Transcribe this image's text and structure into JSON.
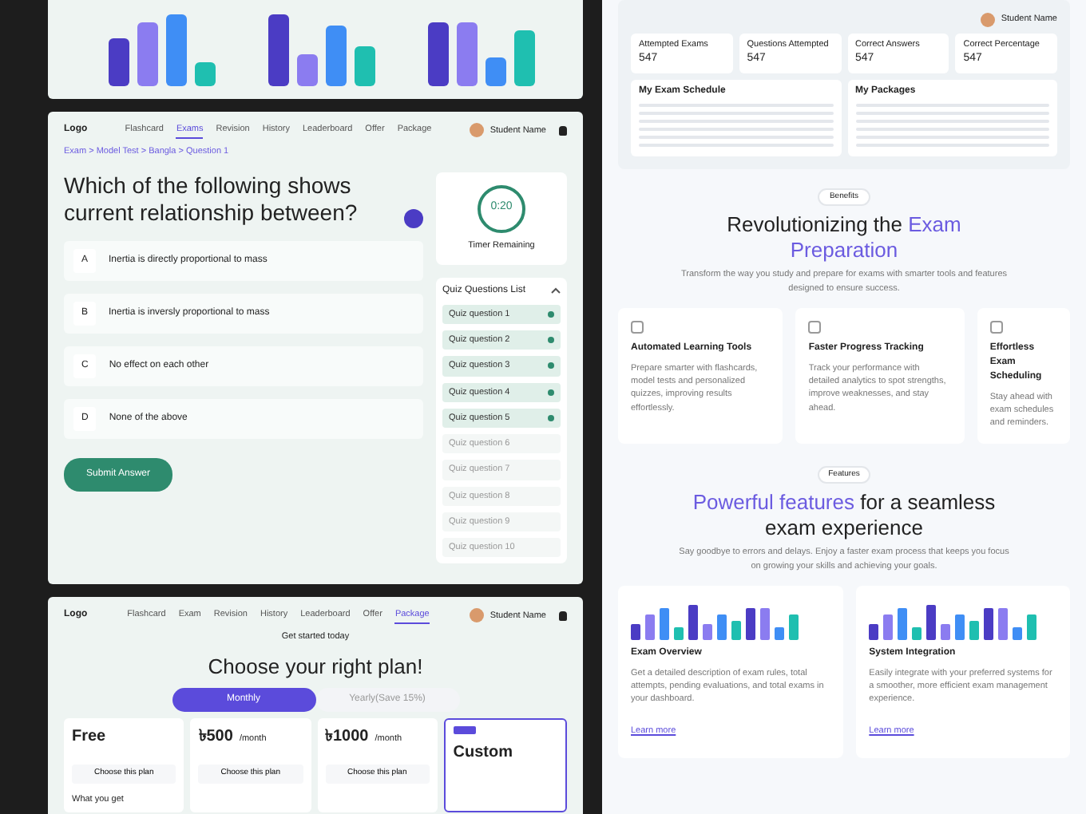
{
  "quiz_page": {
    "logo": "Logo",
    "nav": [
      {
        "label": "Flashcard",
        "selected": false
      },
      {
        "label": "Exams",
        "selected": true
      },
      {
        "label": "Revision",
        "selected": false
      },
      {
        "label": "History",
        "selected": false
      },
      {
        "label": "Leaderboard",
        "selected": false
      },
      {
        "label": "Offer",
        "selected": false
      },
      {
        "label": "Package",
        "selected": false
      }
    ],
    "user_name": "Student Name",
    "breadcrumb": "Exam > Model Test > Bangla > Question 1",
    "question": "Which of the following shows current  relationship between?",
    "options": [
      {
        "letter": "A",
        "text": "Inertia is directly proportional to mass"
      },
      {
        "letter": "B",
        "text": "Inertia is inversly proportional to mass"
      },
      {
        "letter": "C",
        "text": "No effect on each other"
      },
      {
        "letter": "D",
        "text": "None of the above"
      }
    ],
    "submit": "Submit Answer",
    "timer": {
      "time": "0:20",
      "label": "Timer Remaining"
    },
    "list_title": "Quiz Questions List",
    "questions": [
      {
        "label": "Quiz question 1",
        "answered": true
      },
      {
        "label": "Quiz question 2",
        "answered": true
      },
      {
        "label": "Quiz question 3",
        "answered": true
      },
      {
        "label": "Quiz question 4",
        "answered": true
      },
      {
        "label": "Quiz question 5",
        "answered": true
      },
      {
        "label": "Quiz question 6",
        "answered": false
      },
      {
        "label": "Quiz question 7",
        "answered": false
      },
      {
        "label": "Quiz question 8",
        "answered": false
      },
      {
        "label": "Quiz question 9",
        "answered": false
      },
      {
        "label": "Quiz question 10",
        "answered": false
      }
    ]
  },
  "pricing_page": {
    "logo": "Logo",
    "nav": [
      {
        "label": "Flashcard",
        "selected": false
      },
      {
        "label": "Exam",
        "selected": false
      },
      {
        "label": "Revision",
        "selected": false
      },
      {
        "label": "History",
        "selected": false
      },
      {
        "label": "Leaderboard",
        "selected": false
      },
      {
        "label": "Offer",
        "selected": false
      },
      {
        "label": "Package",
        "selected": true
      }
    ],
    "user_name": "Student Name",
    "eyebrow": "Get started today",
    "title": "Choose your right plan!",
    "billing": [
      {
        "label": "Monthly",
        "selected": true
      },
      {
        "label": "Yearly(Save 15%)",
        "selected": false
      }
    ],
    "plans": [
      {
        "price": "Free",
        "button": "Choose this plan",
        "note": "What you get",
        "featured": false
      },
      {
        "price": "৳500",
        "unit": "/month",
        "button": "Choose this plan",
        "featured": false
      },
      {
        "price": "৳1000",
        "unit": "/month",
        "button": "Choose this plan",
        "featured": false
      },
      {
        "price": "Custom",
        "featured": true
      }
    ]
  },
  "dashboard": {
    "user_name": "Student Name",
    "stats": [
      {
        "label": "Attempted Exams",
        "value": "547"
      },
      {
        "label": "Questions Attempted",
        "value": "547"
      },
      {
        "label": "Correct Answers",
        "value": "547"
      },
      {
        "label": "Correct Percentage",
        "value": "547"
      }
    ],
    "tables": [
      {
        "title": "My Exam Schedule"
      },
      {
        "title": "My Packages"
      }
    ]
  },
  "benefits": {
    "tag": "Benefits",
    "title": "Revolutionizing the **Exam Preparation**",
    "subtitle": "Transform the way you study and prepare for exams with smarter tools and features designed to ensure success.",
    "cards": [
      {
        "title": "Automated Learning Tools",
        "text": "Prepare smarter with flashcards, model tests and personalized quizzes, improving results effortlessly."
      },
      {
        "title": "Faster Progress Tracking",
        "text": "Track your performance with detailed analytics to spot strengths, improve weaknesses, and stay ahead."
      },
      {
        "title": "Effortless Exam Scheduling",
        "text": "Stay ahead with exam schedules and reminders."
      }
    ]
  },
  "features": {
    "tag": "Features",
    "title": "**Powerful features** for a seamless exam experience",
    "subtitle": "Say goodbye to errors and delays. Enjoy a faster exam process that keeps you focus on growing your skills and achieving your goals.",
    "cards": [
      {
        "title": "Exam Overview",
        "text": "Get a detailed description of exam rules, total attempts, pending evaluations, and total exams in your dashboard.",
        "link": "Learn more"
      },
      {
        "title": "System Integration",
        "text": "Easily integrate with your preferred systems for a smoother, more efficient exam management experience.",
        "link": "Learn more"
      }
    ]
  }
}
